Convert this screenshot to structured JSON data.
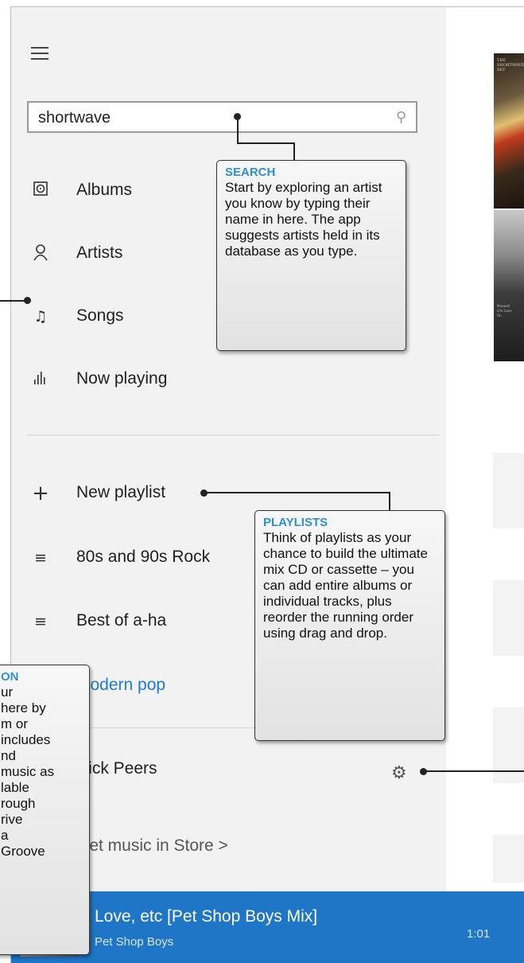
{
  "search": {
    "value": "shortwave"
  },
  "nav": {
    "albums": "Albums",
    "artists": "Artists",
    "songs": "Songs",
    "now_playing": "Now playing",
    "new_playlist": "New playlist",
    "playlists": [
      "80s and 90s Rock",
      "Best of a-ha",
      "Modern pop"
    ],
    "user": "Nick Peers",
    "store": "Get music in Store >"
  },
  "player": {
    "title": "Love, etc [Pet Shop Boys Mix]",
    "artist": "Pet Shop Boys",
    "time": "1:01"
  },
  "callouts": {
    "search": {
      "heading": "SEARCH",
      "body": "Start by exploring an artist you know by typing their name in here. The app suggests artists held in its database as you type."
    },
    "playlists": {
      "heading": "PLAYLISTS",
      "body": "Think of playlists as your chance to build the ultimate mix CD or cassette – you can add entire albums or individual tracks, plus reorder the running order using drag and drop."
    },
    "left": {
      "heading": "ON",
      "body": "ur\nhere by\nm or\nincludes\nnd\nmusic as\nlable\nrough\nrive\na\nGroove"
    }
  },
  "album_art_text": {
    "art1": "THE\nSHORTWAVE\nSET",
    "art2": "Maxwell\nLife Goes\nOn"
  },
  "colors": {
    "accent": "#1f76c6",
    "callout_heading": "#2f8fd3"
  }
}
